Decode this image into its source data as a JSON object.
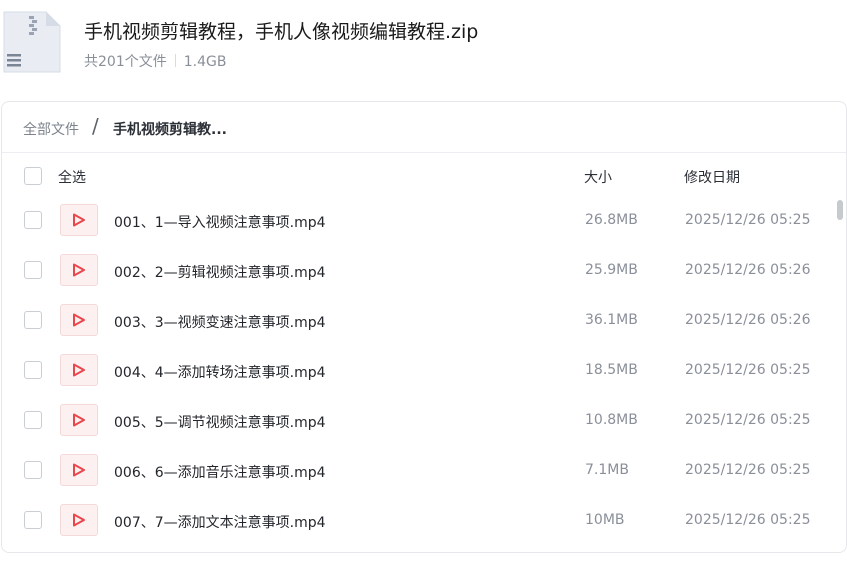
{
  "archive": {
    "icon": "zip-file-icon",
    "title": "手机视频剪辑教程，手机人像视频编辑教程.zip",
    "file_count": "共201个文件",
    "total_size": "1.4GB"
  },
  "breadcrumb": {
    "root": "全部文件",
    "separator": "/",
    "current": "手机视频剪辑教..."
  },
  "table": {
    "select_all": "全选",
    "col_size": "大小",
    "col_modified": "修改日期"
  },
  "colors": {
    "video_icon": "#e8474c",
    "muted_text": "#8a8f99"
  },
  "files": [
    {
      "name": "001、1—导入视频注意事项.mp4",
      "size": "26.8MB",
      "modified": "2025/12/26 05:25"
    },
    {
      "name": "002、2—剪辑视频注意事项.mp4",
      "size": "25.9MB",
      "modified": "2025/12/26 05:26"
    },
    {
      "name": "003、3—视频变速注意事项.mp4",
      "size": "36.1MB",
      "modified": "2025/12/26 05:26"
    },
    {
      "name": "004、4—添加转场注意事项.mp4",
      "size": "18.5MB",
      "modified": "2025/12/26 05:25"
    },
    {
      "name": "005、5—调节视频注意事项.mp4",
      "size": "10.8MB",
      "modified": "2025/12/26 05:25"
    },
    {
      "name": "006、6—添加音乐注意事项.mp4",
      "size": "7.1MB",
      "modified": "2025/12/26 05:25"
    },
    {
      "name": "007、7—添加文本注意事项.mp4",
      "size": "10MB",
      "modified": "2025/12/26 05:25"
    }
  ]
}
